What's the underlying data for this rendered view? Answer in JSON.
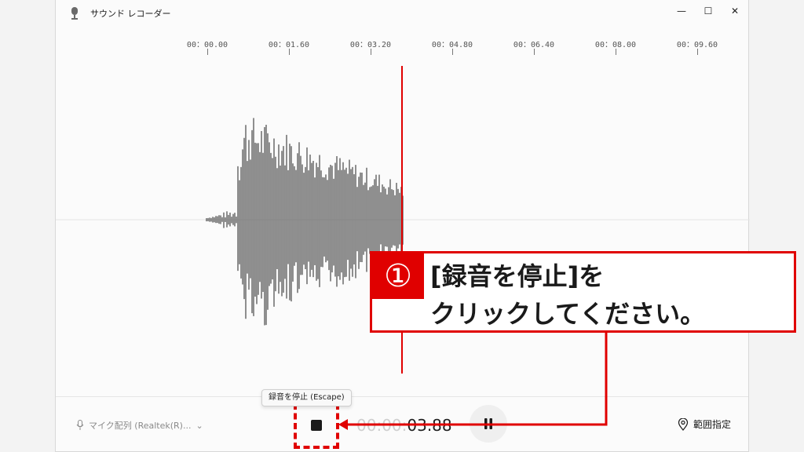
{
  "app": {
    "title": "サウンド レコーダー",
    "icon": "microphone-app-icon",
    "window_buttons": [
      "minimize-icon",
      "maximize-icon",
      "close-icon"
    ]
  },
  "timeline": {
    "ticks": [
      "00：00.00",
      "00：01.60",
      "00：03.20",
      "00：04.80",
      "00：06.40",
      "00：08.00",
      "00：09.60"
    ]
  },
  "recording": {
    "elapsed_dim": "00:00:",
    "elapsed_bright": "03.88",
    "playhead_color": "#e00000"
  },
  "controls": {
    "mic_label": "マイク配列 (Realtek(R)...",
    "stop_icon": "stop-icon",
    "pause_icon": "pause-icon",
    "range_label": "範囲指定",
    "range_icon": "location-pin-icon",
    "tooltip": "録音を停止 (Escape)"
  },
  "callout": {
    "number": "①",
    "line1": "[録音を停止]を",
    "line2": "クリックしてください。",
    "color": "#e00000"
  }
}
